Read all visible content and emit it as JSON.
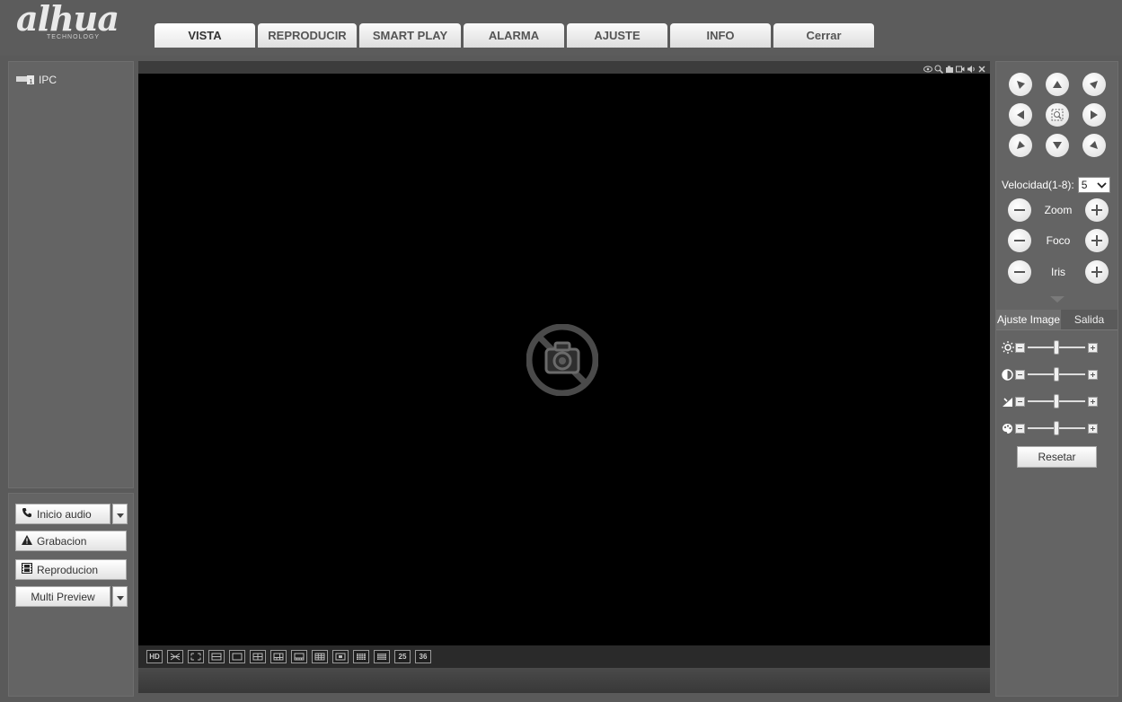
{
  "header": {
    "logo_text": "alhua",
    "logo_sub": "TECHNOLOGY",
    "tabs": [
      {
        "label": "VISTA",
        "active": true
      },
      {
        "label": "REPRODUCIR",
        "active": false
      },
      {
        "label": "SMART PLAY",
        "active": false
      },
      {
        "label": "ALARMA",
        "active": false
      },
      {
        "label": "AJUSTE",
        "active": false
      },
      {
        "label": "INFO",
        "active": false
      },
      {
        "label": "Cerrar",
        "active": false
      }
    ]
  },
  "device_tree": {
    "items": [
      {
        "label": "IPC",
        "icon": "camera-device-icon"
      }
    ]
  },
  "left_actions": {
    "talk_label": "Inicio audio",
    "record_label": "Grabacion",
    "playback_label": "Reproducion",
    "multi_preview_label": "Multi Preview"
  },
  "video": {
    "toolbar_icons": [
      "eye-icon",
      "zoom-icon",
      "snapshot-icon",
      "record-icon",
      "audio-icon",
      "close-icon"
    ],
    "placeholder_icon": "no-camera-icon",
    "layouts": [
      {
        "label": "HD",
        "icon": "hd-icon"
      },
      {
        "label": "",
        "icon": "fluency-icon"
      },
      {
        "label": "",
        "icon": "fullscreen-icon"
      },
      {
        "label": "",
        "icon": "fit-window-icon"
      },
      {
        "label": "",
        "icon": "layout-1-icon"
      },
      {
        "label": "",
        "icon": "layout-4-icon"
      },
      {
        "label": "",
        "icon": "layout-6-icon"
      },
      {
        "label": "",
        "icon": "layout-8-icon"
      },
      {
        "label": "",
        "icon": "layout-9-icon"
      },
      {
        "label": "",
        "icon": "layout-13-icon"
      },
      {
        "label": "",
        "icon": "layout-16-icon"
      },
      {
        "label": "",
        "icon": "layout-20-icon"
      },
      {
        "label": "25",
        "icon": "layout-25-icon"
      },
      {
        "label": "36",
        "icon": "layout-36-icon"
      }
    ]
  },
  "ptz": {
    "speed_label": "Velocidad(1-8):",
    "speed_value": "5",
    "zoom_label": "Zoom",
    "focus_label": "Foco",
    "iris_label": "Iris"
  },
  "image_settings": {
    "tabs": [
      {
        "label": "Ajuste Image",
        "active": true
      },
      {
        "label": "Salida",
        "active": false
      }
    ],
    "sliders": [
      {
        "icon": "brightness-icon",
        "value": 0.5
      },
      {
        "icon": "contrast-icon",
        "value": 0.5
      },
      {
        "icon": "saturation-icon",
        "value": 0.5
      },
      {
        "icon": "hue-icon",
        "value": 0.5
      }
    ],
    "reset_label": "Resetar"
  }
}
